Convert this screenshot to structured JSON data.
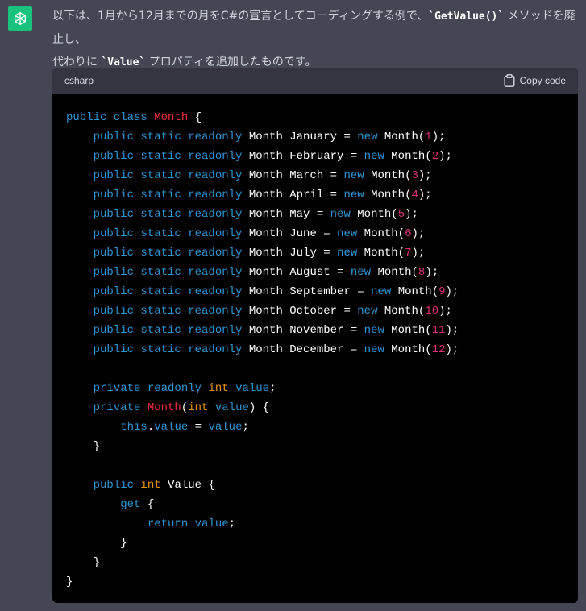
{
  "assistant_icon": "openai-logo-icon",
  "message": {
    "line1_before": "以下は、1月から12月までの月をC#の宣言としてコーディングする例で、",
    "line1_code": "`GetValue()`",
    "line1_after": "メソッドを廃止し、",
    "line2_before": "代わりに ",
    "line2_code": "`Value`",
    "line2_after": "プロパティを追加したものです。"
  },
  "code_block": {
    "language": "csharp",
    "copy_label": "Copy code",
    "copy_icon": "clipboard-icon",
    "lines": [
      [
        {
          "t": "public class ",
          "c": "kw"
        },
        {
          "t": "Month",
          "c": "ty"
        },
        {
          "t": " {",
          "c": "id"
        }
      ],
      [
        {
          "t": "    public static readonly ",
          "c": "kw"
        },
        {
          "t": "Month January = ",
          "c": "id"
        },
        {
          "t": "new ",
          "c": "kw"
        },
        {
          "t": "Month(",
          "c": "id"
        },
        {
          "t": "1",
          "c": "num"
        },
        {
          "t": ");",
          "c": "id"
        }
      ],
      [
        {
          "t": "    public static readonly ",
          "c": "kw"
        },
        {
          "t": "Month February = ",
          "c": "id"
        },
        {
          "t": "new ",
          "c": "kw"
        },
        {
          "t": "Month(",
          "c": "id"
        },
        {
          "t": "2",
          "c": "num"
        },
        {
          "t": ");",
          "c": "id"
        }
      ],
      [
        {
          "t": "    public static readonly ",
          "c": "kw"
        },
        {
          "t": "Month March = ",
          "c": "id"
        },
        {
          "t": "new ",
          "c": "kw"
        },
        {
          "t": "Month(",
          "c": "id"
        },
        {
          "t": "3",
          "c": "num"
        },
        {
          "t": ");",
          "c": "id"
        }
      ],
      [
        {
          "t": "    public static readonly ",
          "c": "kw"
        },
        {
          "t": "Month April = ",
          "c": "id"
        },
        {
          "t": "new ",
          "c": "kw"
        },
        {
          "t": "Month(",
          "c": "id"
        },
        {
          "t": "4",
          "c": "num"
        },
        {
          "t": ");",
          "c": "id"
        }
      ],
      [
        {
          "t": "    public static readonly ",
          "c": "kw"
        },
        {
          "t": "Month May = ",
          "c": "id"
        },
        {
          "t": "new ",
          "c": "kw"
        },
        {
          "t": "Month(",
          "c": "id"
        },
        {
          "t": "5",
          "c": "num"
        },
        {
          "t": ");",
          "c": "id"
        }
      ],
      [
        {
          "t": "    public static readonly ",
          "c": "kw"
        },
        {
          "t": "Month June = ",
          "c": "id"
        },
        {
          "t": "new ",
          "c": "kw"
        },
        {
          "t": "Month(",
          "c": "id"
        },
        {
          "t": "6",
          "c": "num"
        },
        {
          "t": ");",
          "c": "id"
        }
      ],
      [
        {
          "t": "    public static readonly ",
          "c": "kw"
        },
        {
          "t": "Month July = ",
          "c": "id"
        },
        {
          "t": "new ",
          "c": "kw"
        },
        {
          "t": "Month(",
          "c": "id"
        },
        {
          "t": "7",
          "c": "num"
        },
        {
          "t": ");",
          "c": "id"
        }
      ],
      [
        {
          "t": "    public static readonly ",
          "c": "kw"
        },
        {
          "t": "Month August = ",
          "c": "id"
        },
        {
          "t": "new ",
          "c": "kw"
        },
        {
          "t": "Month(",
          "c": "id"
        },
        {
          "t": "8",
          "c": "num"
        },
        {
          "t": ");",
          "c": "id"
        }
      ],
      [
        {
          "t": "    public static readonly ",
          "c": "kw"
        },
        {
          "t": "Month September = ",
          "c": "id"
        },
        {
          "t": "new ",
          "c": "kw"
        },
        {
          "t": "Month(",
          "c": "id"
        },
        {
          "t": "9",
          "c": "num"
        },
        {
          "t": ");",
          "c": "id"
        }
      ],
      [
        {
          "t": "    public static readonly ",
          "c": "kw"
        },
        {
          "t": "Month October = ",
          "c": "id"
        },
        {
          "t": "new ",
          "c": "kw"
        },
        {
          "t": "Month(",
          "c": "id"
        },
        {
          "t": "10",
          "c": "num"
        },
        {
          "t": ");",
          "c": "id"
        }
      ],
      [
        {
          "t": "    public static readonly ",
          "c": "kw"
        },
        {
          "t": "Month November = ",
          "c": "id"
        },
        {
          "t": "new ",
          "c": "kw"
        },
        {
          "t": "Month(",
          "c": "id"
        },
        {
          "t": "11",
          "c": "num"
        },
        {
          "t": ");",
          "c": "id"
        }
      ],
      [
        {
          "t": "    public static readonly ",
          "c": "kw"
        },
        {
          "t": "Month December = ",
          "c": "id"
        },
        {
          "t": "new ",
          "c": "kw"
        },
        {
          "t": "Month(",
          "c": "id"
        },
        {
          "t": "12",
          "c": "num"
        },
        {
          "t": ");",
          "c": "id"
        }
      ],
      [],
      [
        {
          "t": "    private readonly ",
          "c": "kw"
        },
        {
          "t": "int",
          "c": "prim"
        },
        {
          "t": " ",
          "c": "id"
        },
        {
          "t": "value",
          "c": "kw"
        },
        {
          "t": ";",
          "c": "id"
        }
      ],
      [
        {
          "t": "    private ",
          "c": "kw"
        },
        {
          "t": "Month",
          "c": "ty"
        },
        {
          "t": "(",
          "c": "id"
        },
        {
          "t": "int",
          "c": "prim"
        },
        {
          "t": " ",
          "c": "id"
        },
        {
          "t": "value",
          "c": "kw"
        },
        {
          "t": ") {",
          "c": "id"
        }
      ],
      [
        {
          "t": "        this",
          "c": "kw"
        },
        {
          "t": ".",
          "c": "id"
        },
        {
          "t": "value",
          "c": "kw"
        },
        {
          "t": " = ",
          "c": "id"
        },
        {
          "t": "value",
          "c": "kw"
        },
        {
          "t": ";",
          "c": "id"
        }
      ],
      [
        {
          "t": "    }",
          "c": "id"
        }
      ],
      [],
      [
        {
          "t": "    public ",
          "c": "kw"
        },
        {
          "t": "int",
          "c": "prim"
        },
        {
          "t": " Value {",
          "c": "id"
        }
      ],
      [
        {
          "t": "        get",
          "c": "kw"
        },
        {
          "t": " {",
          "c": "id"
        }
      ],
      [
        {
          "t": "            return ",
          "c": "kw"
        },
        {
          "t": "value",
          "c": "kw"
        },
        {
          "t": ";",
          "c": "id"
        }
      ],
      [
        {
          "t": "        }",
          "c": "id"
        }
      ],
      [
        {
          "t": "    }",
          "c": "id"
        }
      ],
      [
        {
          "t": "}",
          "c": "id"
        }
      ]
    ]
  },
  "colors": {
    "background": "#444654",
    "code_background": "#000000",
    "code_header": "#343541",
    "keyword": "#2e95d3",
    "type_name": "#f22c3d",
    "number": "#df3079",
    "primitive": "#e9950c",
    "accent": "#19c37d"
  }
}
